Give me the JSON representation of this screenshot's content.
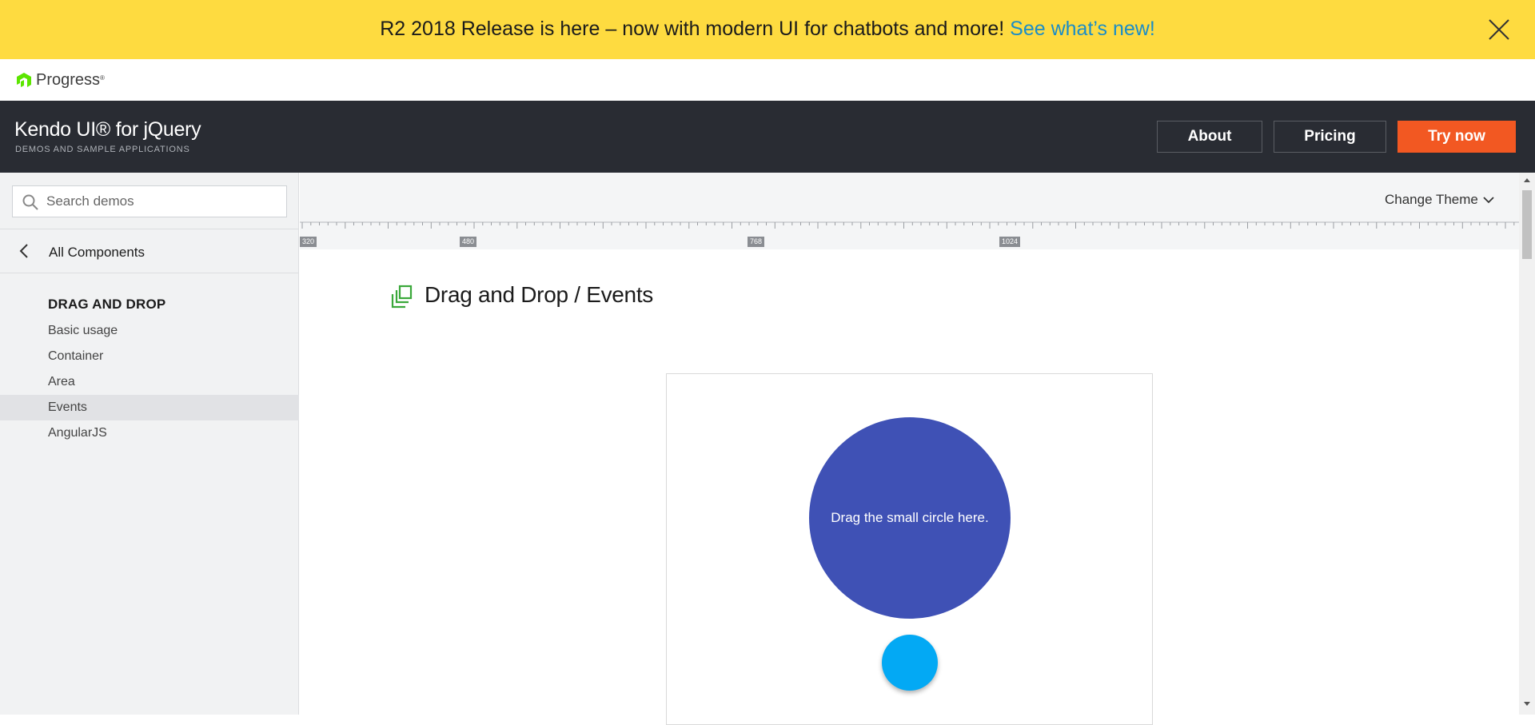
{
  "banner": {
    "text": "R2 2018 Release is here – now with modern UI for chatbots and more!",
    "link": "See what’s new!",
    "close_icon": "close-icon"
  },
  "progress": {
    "name": "Progress",
    "tm": "®",
    "brand_color": "#5ce500"
  },
  "header": {
    "title": "Kendo UI® for jQuery",
    "subtitle": "DEMOS AND SAMPLE APPLICATIONS",
    "buttons": {
      "about": "About",
      "pricing": "Pricing",
      "try_now": "Try now"
    },
    "accent": "#f25822"
  },
  "sidebar": {
    "search_placeholder": "Search demos",
    "back_label": "All Components",
    "section": "DRAG AND DROP",
    "items": [
      {
        "label": "Basic usage",
        "active": false
      },
      {
        "label": "Container",
        "active": false
      },
      {
        "label": "Area",
        "active": false
      },
      {
        "label": "Events",
        "active": true
      },
      {
        "label": "AngularJS",
        "active": false
      }
    ]
  },
  "content": {
    "change_theme": "Change Theme",
    "ruler_labels": [
      "320",
      "480",
      "768",
      "1024"
    ],
    "page_title": "Drag and Drop / Events",
    "drop_target_text": "Drag the small circle here.",
    "drop_target_color": "#3f51b5",
    "draggable_color": "#03a9f4"
  }
}
